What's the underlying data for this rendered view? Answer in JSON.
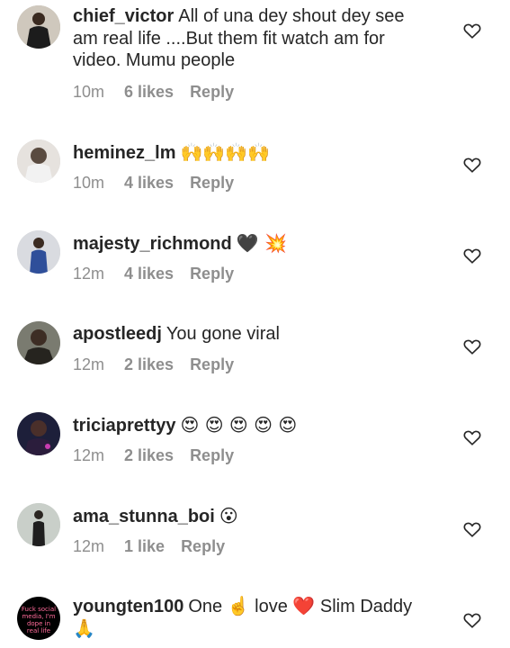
{
  "comments": [
    {
      "username": "chief_victor",
      "text": "All of una dey shout dey see am real life ....But them fit watch am for video.  Mumu people",
      "time": "10m",
      "likes": "6 likes",
      "reply": "Reply"
    },
    {
      "username": "heminez_lm",
      "text": "🙌🙌🙌🙌",
      "time": "10m",
      "likes": "4 likes",
      "reply": "Reply"
    },
    {
      "username": "majesty_richmond",
      "text": "🖤 💥",
      "time": "12m",
      "likes": "4 likes",
      "reply": "Reply"
    },
    {
      "username": "apostleedj",
      "text": "You gone viral",
      "time": "12m",
      "likes": "2 likes",
      "reply": "Reply"
    },
    {
      "username": "triciaprettyy",
      "text": "😍 😍 😍 😍 😍",
      "time": "12m",
      "likes": "2 likes",
      "reply": "Reply"
    },
    {
      "username": "ama_stunna_boi",
      "text": "😮",
      "time": "12m",
      "likes": "1 like",
      "reply": "Reply"
    },
    {
      "username": "youngten100",
      "text": "One ☝️ love ❤️ Slim Daddy 🙏"
    }
  ],
  "avatar_7_text": "Fuck social media, I'm dope in real life",
  "icons": {
    "like": "heart-outline-icon"
  }
}
